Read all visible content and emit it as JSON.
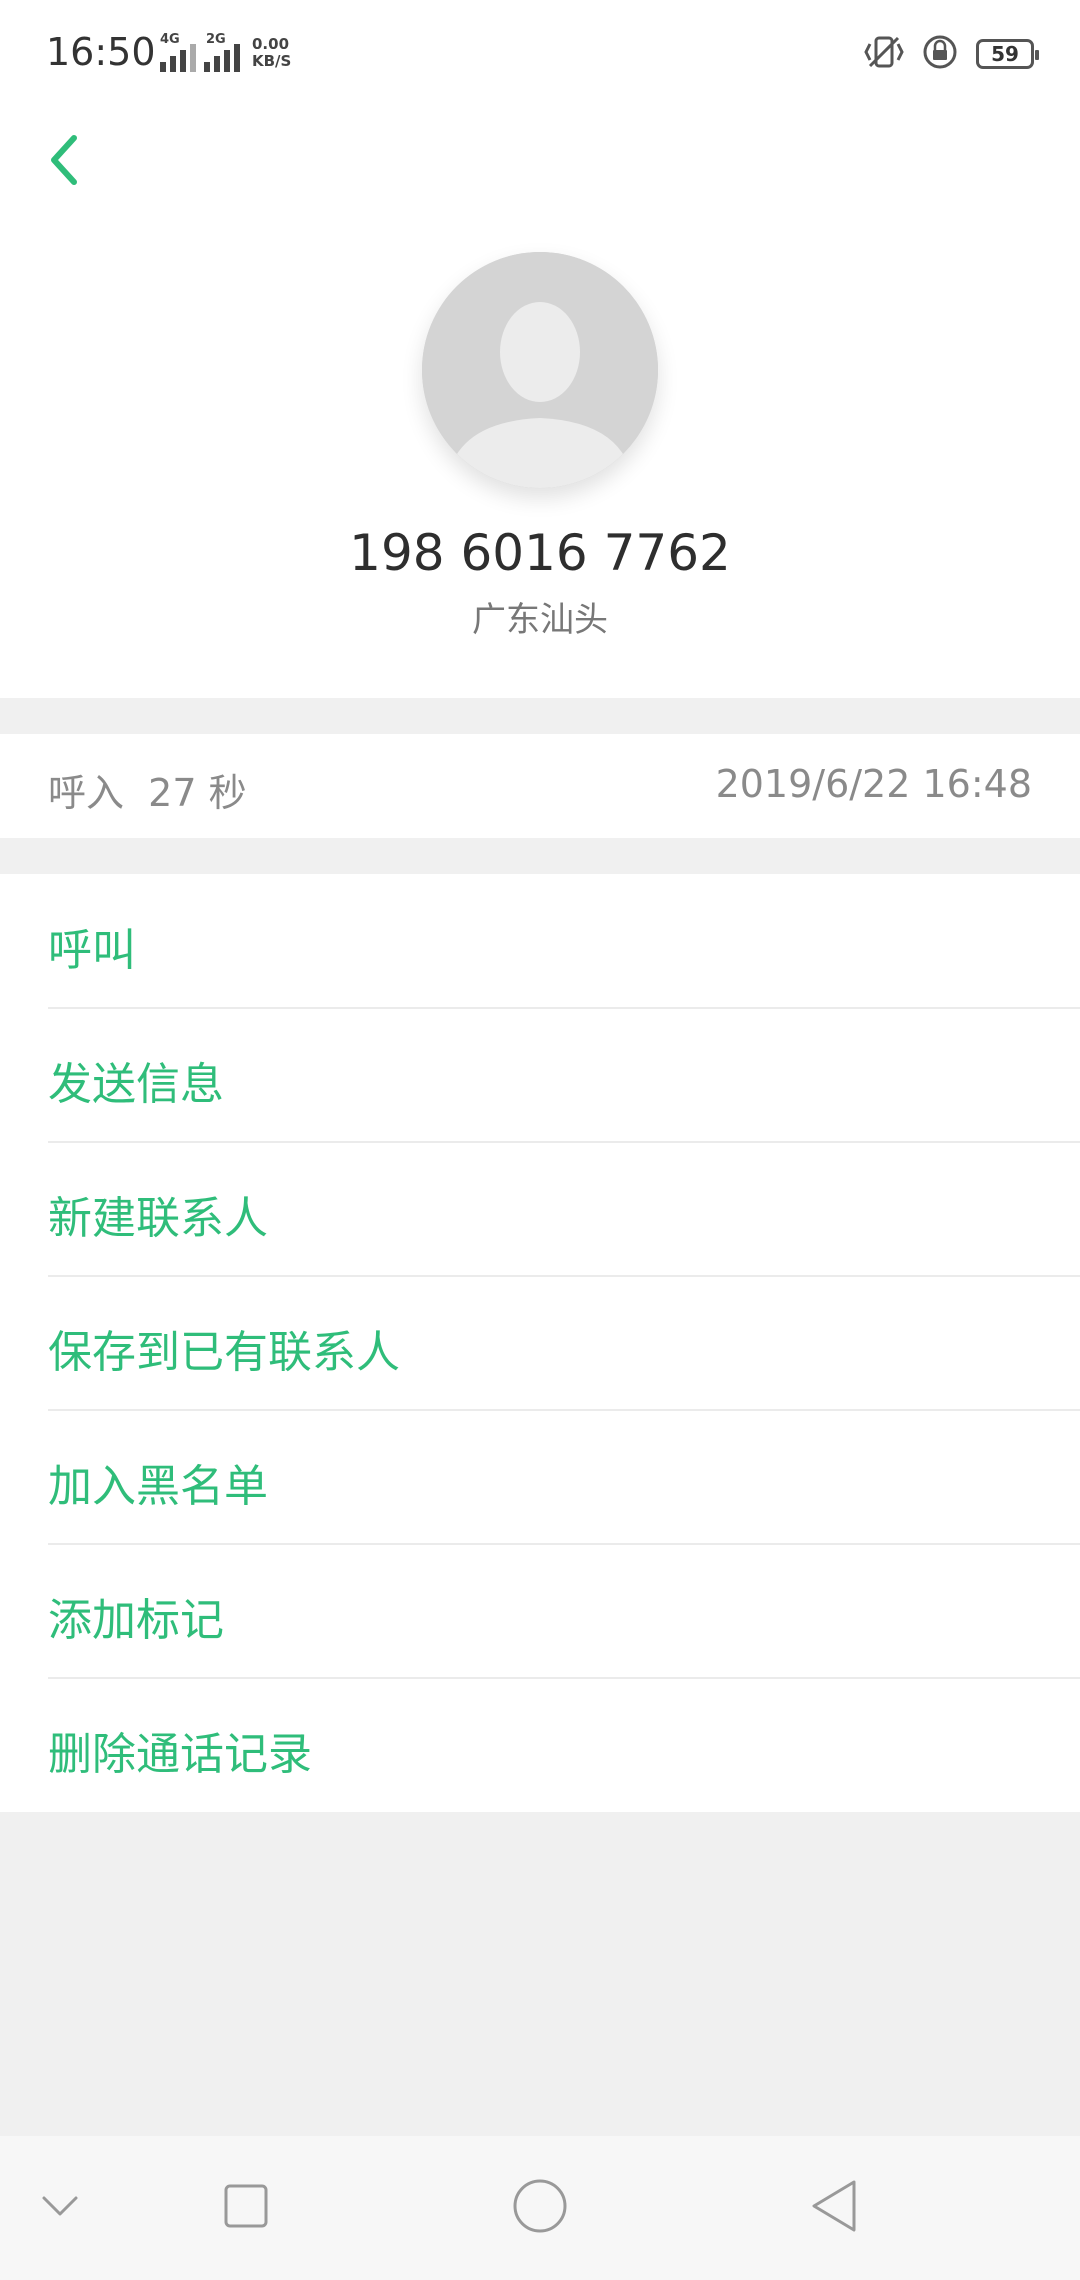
{
  "status_bar": {
    "time": "16:50",
    "sig1_label": "4G",
    "sig2_label": "2G",
    "net_speed_value": "0.00",
    "net_speed_unit": "KB/S",
    "battery": "59"
  },
  "contact": {
    "number": "198 6016 7762",
    "location": "广东汕头"
  },
  "call_log": {
    "type": "呼入  27 秒",
    "datetime": "2019/6/22 16:48"
  },
  "actions": [
    {
      "label": "呼叫"
    },
    {
      "label": "发送信息"
    },
    {
      "label": "新建联系人"
    },
    {
      "label": "保存到已有联系人"
    },
    {
      "label": "加入黑名单"
    },
    {
      "label": "添加标记"
    },
    {
      "label": "删除通话记录"
    }
  ],
  "colors": {
    "accent": "#2fbd7a",
    "secondary_text": "#8a8a8a",
    "background": "#f0f0f0"
  },
  "icons": {
    "back": "chevron-left-icon",
    "vibrate": "vibrate-icon",
    "lock": "lock-icon",
    "nav_down": "chevron-down-icon",
    "nav_recents": "square-icon",
    "nav_home": "circle-icon",
    "nav_back": "triangle-back-icon"
  }
}
